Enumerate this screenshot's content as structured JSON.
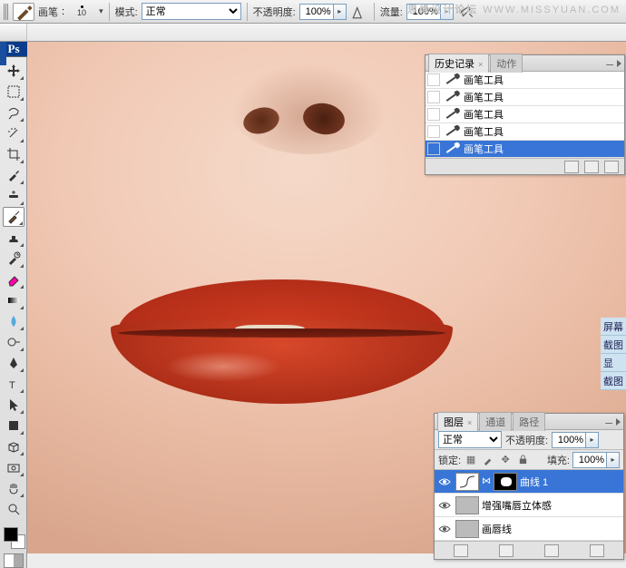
{
  "watermark": {
    "cn": "思缘设计论坛",
    "en": "WWW.MISSYUAN.COM"
  },
  "options": {
    "tool_label": "画笔",
    "brush_size": "10",
    "mode_label": "模式:",
    "mode_value": "正常",
    "opacity_label": "不透明度:",
    "opacity_value": "100%",
    "flow_label": "流量:",
    "flow_value": "100%"
  },
  "history_panel": {
    "tab_history": "历史记录",
    "tab_actions": "动作",
    "items": [
      {
        "label": "画笔工具",
        "selected": false
      },
      {
        "label": "画笔工具",
        "selected": false
      },
      {
        "label": "画笔工具",
        "selected": false
      },
      {
        "label": "画笔工具",
        "selected": false
      },
      {
        "label": "画笔工具",
        "selected": true
      }
    ]
  },
  "right_slice": {
    "items": [
      "屏幕",
      "截图",
      "显",
      "截图"
    ]
  },
  "layers_panel": {
    "tab_layers": "图层",
    "tab_channels": "通道",
    "tab_paths": "路径",
    "blend_mode": "正常",
    "opacity_label": "不透明度:",
    "opacity_value": "100%",
    "lock_label": "锁定:",
    "fill_label": "填充:",
    "fill_value": "100%",
    "layers": [
      {
        "name": "曲线 1",
        "selected": true,
        "type": "curves"
      },
      {
        "name": "增强嘴唇立体感",
        "selected": false,
        "type": "gray"
      },
      {
        "name": "画唇线",
        "selected": false,
        "type": "gray"
      }
    ]
  },
  "ps": "Ps"
}
